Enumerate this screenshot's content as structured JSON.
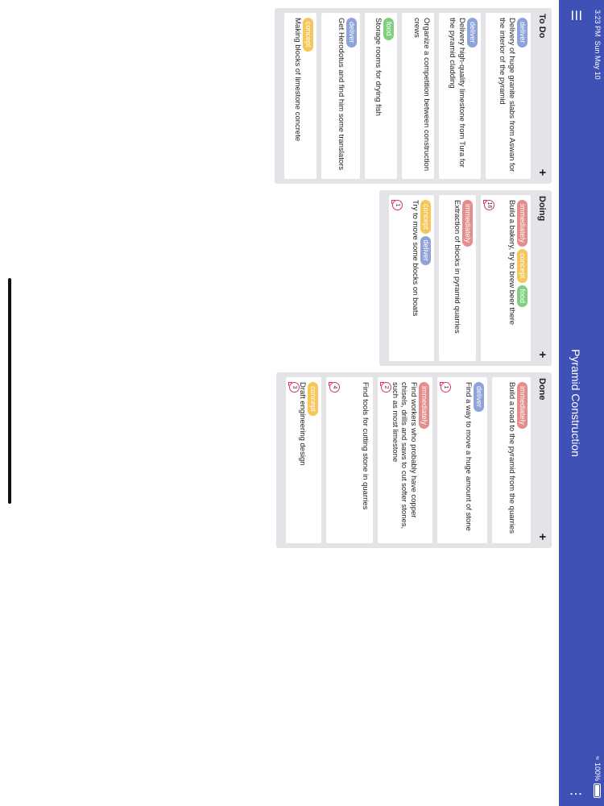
{
  "status": {
    "time": "3:23 PM",
    "date": "Sun May 10",
    "wifi": "WiFi",
    "battery": "100%"
  },
  "appbar": {
    "title": "Pyramid Construction",
    "menu_icon": "menu-icon",
    "more_icon": "more-vert-icon"
  },
  "colors": {
    "primary": "#3f51b5",
    "column_bg": "#e4e4e8",
    "tag_deliver": "#8fa3db",
    "tag_immediately": "#e58c8c",
    "tag_concept": "#f6c65b",
    "tag_food": "#7fcf7f",
    "badge": "#e0306a"
  },
  "columns": [
    {
      "title": "To Do",
      "add": "+",
      "cards": [
        {
          "tags": [
            "deliver"
          ],
          "text": "Delivery of huge granite slabs from Aswan for the interior of the pyramid"
        },
        {
          "tags": [
            "deliver"
          ],
          "text": "Delivery high-quality limestone from Tura for the pyramid cladding"
        },
        {
          "tags": [],
          "text": "Organize a competition between construction crews"
        },
        {
          "tags": [
            "food"
          ],
          "text": "Storage rooms for drying fish"
        },
        {
          "tags": [
            "deliver"
          ],
          "text": "Get Herodotus and find him some translators"
        },
        {
          "tags": [
            "concept"
          ],
          "text": "Making blocks of limestone concrete"
        }
      ]
    },
    {
      "title": "Doing",
      "add": "+",
      "cards": [
        {
          "tags": [
            "immediately",
            "concept",
            "food"
          ],
          "text": "Build a bakery, try to brew beer there",
          "badge": "16"
        },
        {
          "tags": [
            "immediately"
          ],
          "text": "Extraction of blocks in pyramid quarries"
        },
        {
          "tags": [
            "concept",
            "deliver"
          ],
          "text": "Try to move some blocks on boats",
          "badge": "1"
        }
      ]
    },
    {
      "title": "Done",
      "add": "+",
      "cards": [
        {
          "tags": [
            "immediately"
          ],
          "text": "Build a road to the pyramid from the quarries"
        },
        {
          "tags": [
            "deliver"
          ],
          "text": "Find a way to move a huge amount of stone",
          "badge": "1"
        },
        {
          "tags": [
            "immediately"
          ],
          "text": "Find workers who probably have copper chisels, drills and saws to cut softer stones, such as most limestone",
          "badge": "2"
        },
        {
          "tags": [],
          "text": "Find tools for cutting stone in quarries",
          "badge": "4"
        },
        {
          "tags": [
            "concept"
          ],
          "text": "Draft engineering design",
          "badge": "3"
        }
      ]
    }
  ]
}
